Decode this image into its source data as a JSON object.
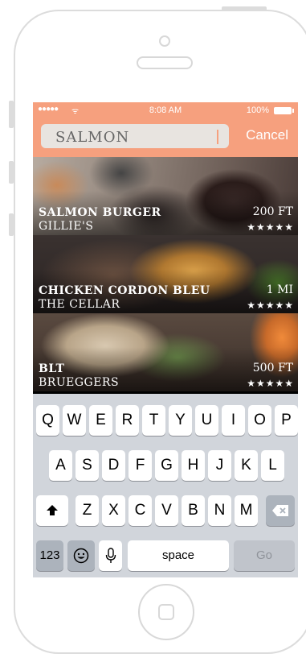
{
  "status_bar": {
    "signal": "●●●●●",
    "wifi": "ᯤ",
    "time": "8:08 AM",
    "battery": "100%"
  },
  "search": {
    "value": "SALMON",
    "cancel_label": "Cancel"
  },
  "results": [
    {
      "name": "SALMON BURGER",
      "place": "GILLIE'S",
      "distance": "200 FT",
      "rating": 5,
      "stars": "★★★★★"
    },
    {
      "name": "CHICKEN CORDON BLEU",
      "place": "THE CELLAR",
      "distance": "1 MI",
      "rating": 5,
      "stars": "★★★★★"
    },
    {
      "name": "BLT",
      "place": "BRUEGGERS",
      "distance": "500 FT",
      "rating": 5,
      "stars": "★★★★★"
    }
  ],
  "keyboard": {
    "row1": [
      "Q",
      "W",
      "E",
      "R",
      "T",
      "Y",
      "U",
      "I",
      "O",
      "P"
    ],
    "row2": [
      "A",
      "S",
      "D",
      "F",
      "G",
      "H",
      "J",
      "K",
      "L"
    ],
    "row3": [
      "Z",
      "X",
      "C",
      "V",
      "B",
      "N",
      "M"
    ],
    "shift_icon": "shift-arrow",
    "backspace_icon": "backspace",
    "numbers_label": "123",
    "emoji_icon": "emoji",
    "mic_icon": "microphone",
    "space_label": "space",
    "go_label": "Go"
  },
  "colors": {
    "accent": "#f6a07e",
    "keyboard_bg": "#d1d5db"
  }
}
